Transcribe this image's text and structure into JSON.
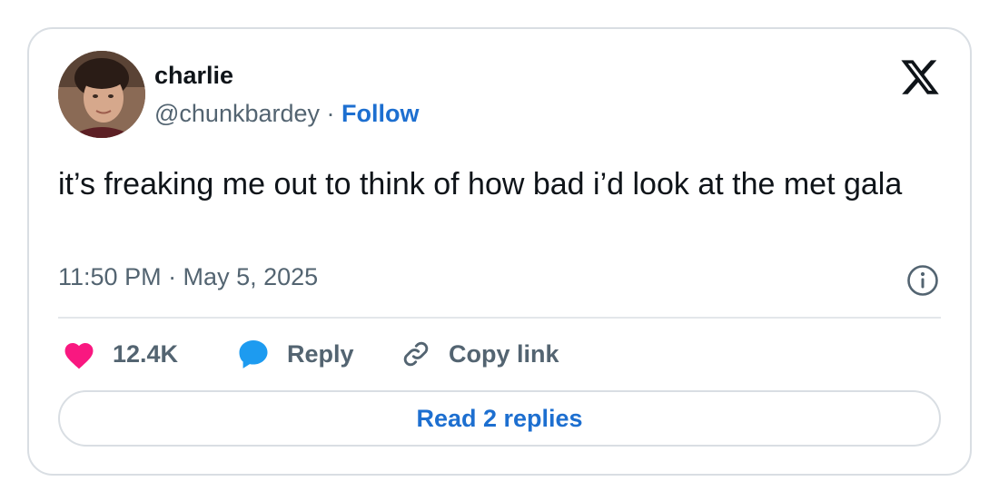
{
  "author": {
    "display_name": "charlie",
    "handle": "@chunkbardey",
    "separator": " · ",
    "follow_label": "Follow"
  },
  "tweet": {
    "text": "it’s freaking me out to think of how bad i’d look at the met gala",
    "timestamp": "11:50 PM · May 5, 2025"
  },
  "actions": {
    "like_count": "12.4K",
    "reply_label": "Reply",
    "copy_link_label": "Copy link",
    "read_replies_label": "Read 2 replies"
  },
  "icons": {
    "brand": "x-logo-icon",
    "info": "info-icon",
    "like": "heart-icon",
    "reply": "speech-bubble-icon",
    "copy": "link-icon"
  },
  "colors": {
    "heart": "#f91880",
    "reply_bubble": "#1d9bf0",
    "link_blue": "#1d6fd0",
    "muted_text": "#536471",
    "primary_text": "#0f1419",
    "border": "#d9dee3"
  }
}
